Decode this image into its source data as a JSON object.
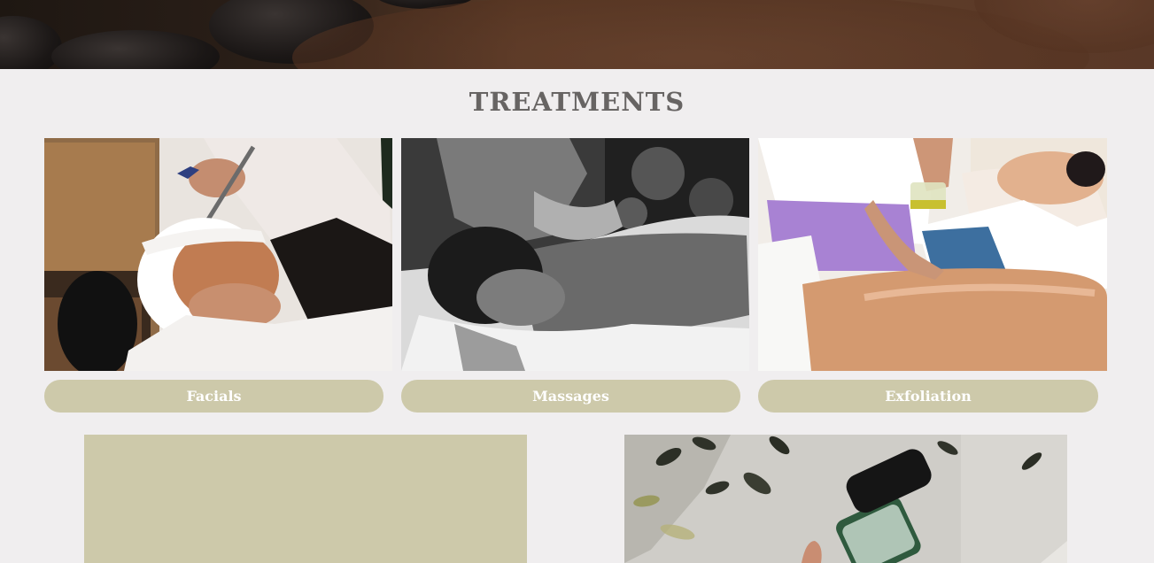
{
  "section": {
    "title": "TREATMENTS"
  },
  "treatments": [
    {
      "label": "Facials",
      "image": "facial-mask-photo"
    },
    {
      "label": "Massages",
      "image": "back-massage-photo"
    },
    {
      "label": "Exfoliation",
      "image": "oil-body-treatment-photo"
    }
  ],
  "colors": {
    "page_background": "#f0eeef",
    "accent_olive": "#cdc9aa",
    "title_gray": "#676463",
    "button_text": "#ffffff"
  }
}
